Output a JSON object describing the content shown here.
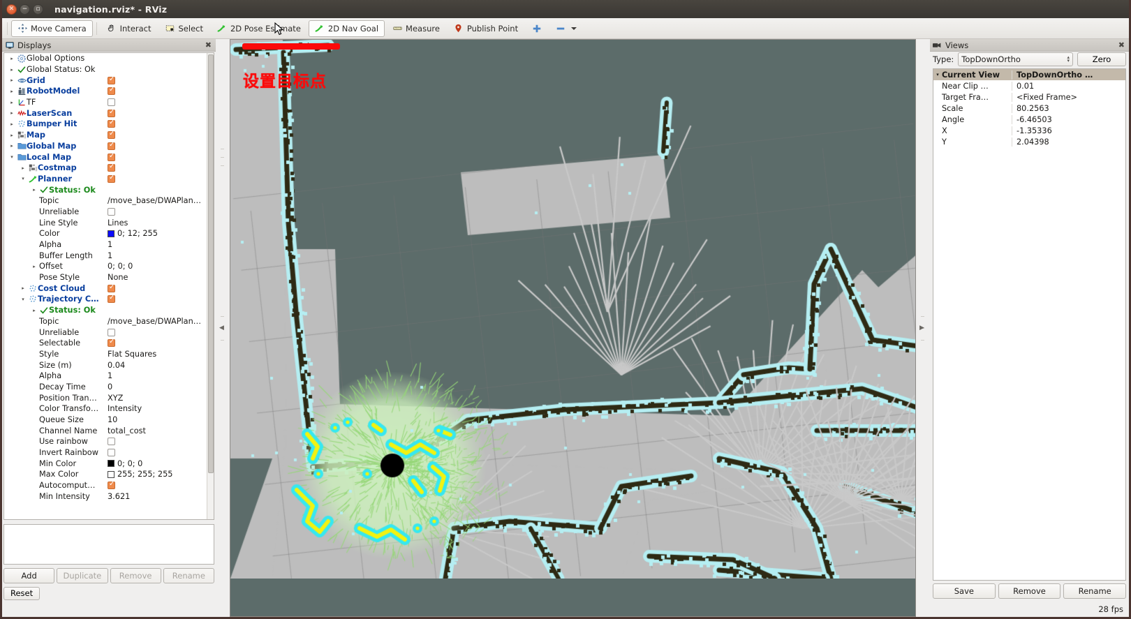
{
  "window": {
    "title": "navigation.rviz* - RViz",
    "controls": [
      "close-button",
      "minimize-button",
      "maximize-button"
    ]
  },
  "toolbar": {
    "items": [
      {
        "label": "Move Camera",
        "icon": "move-camera-icon",
        "active": true
      },
      {
        "label": "Interact",
        "icon": "hand-interact-icon",
        "active": false
      },
      {
        "label": "Select",
        "icon": "select-marquee-icon",
        "active": false
      },
      {
        "label": "2D Pose Estimate",
        "icon": "pose-arrow-icon",
        "active": false
      },
      {
        "label": "2D Nav Goal",
        "icon": "nav-goal-arrow-icon",
        "active": true
      },
      {
        "label": "Measure",
        "icon": "measure-icon",
        "active": false
      },
      {
        "label": "Publish Point",
        "icon": "map-pin-icon",
        "active": false
      },
      {
        "label": "",
        "icon": "plus-icon",
        "active": false
      },
      {
        "label": "",
        "icon": "minus-icon",
        "active": false
      }
    ]
  },
  "displays": {
    "title": "Displays",
    "tree": [
      {
        "indent": 0,
        "arrow": "▸",
        "icon": "gear-icon",
        "label": "Global Options",
        "style": "plain",
        "value": null,
        "check": null
      },
      {
        "indent": 0,
        "arrow": "▸",
        "icon": "check-icon",
        "label": "Global Status: Ok",
        "style": "plain",
        "value": null,
        "check": null
      },
      {
        "indent": 0,
        "arrow": "▸",
        "icon": "grid-icon",
        "label": "Grid",
        "style": "display",
        "value": null,
        "check": true
      },
      {
        "indent": 0,
        "arrow": "▸",
        "icon": "robot-icon",
        "label": "RobotModel",
        "style": "display",
        "value": null,
        "check": true
      },
      {
        "indent": 0,
        "arrow": "▸",
        "icon": "tf-axes-icon",
        "label": "TF",
        "style": "plain",
        "value": null,
        "check": false
      },
      {
        "indent": 0,
        "arrow": "▸",
        "icon": "laserscan-icon",
        "label": "LaserScan",
        "style": "display",
        "value": null,
        "check": true
      },
      {
        "indent": 0,
        "arrow": "▸",
        "icon": "pointcloud-icon",
        "label": "Bumper Hit",
        "style": "display",
        "value": null,
        "check": true
      },
      {
        "indent": 0,
        "arrow": "▸",
        "icon": "map-icon",
        "label": "Map",
        "style": "display",
        "value": null,
        "check": true
      },
      {
        "indent": 0,
        "arrow": "▸",
        "icon": "folder-icon",
        "label": "Global Map",
        "style": "display",
        "value": null,
        "check": true
      },
      {
        "indent": 0,
        "arrow": "▾",
        "icon": "folder-icon",
        "label": "Local Map",
        "style": "display",
        "value": null,
        "check": true
      },
      {
        "indent": 1,
        "arrow": "▸",
        "icon": "map-icon",
        "label": "Costmap",
        "style": "display",
        "value": null,
        "check": true
      },
      {
        "indent": 1,
        "arrow": "▾",
        "icon": "path-icon",
        "label": "Planner",
        "style": "display",
        "value": null,
        "check": true
      },
      {
        "indent": 2,
        "arrow": "▸",
        "icon": "check-icon",
        "label": "Status: Ok",
        "style": "plain",
        "value": null,
        "check": null
      },
      {
        "indent": 2,
        "arrow": "",
        "icon": "",
        "label": "Topic",
        "style": "prop",
        "value": "/move_base/DWAPlan…",
        "check": null
      },
      {
        "indent": 2,
        "arrow": "",
        "icon": "",
        "label": "Unreliable",
        "style": "prop",
        "value": null,
        "check": false
      },
      {
        "indent": 2,
        "arrow": "",
        "icon": "",
        "label": "Line Style",
        "style": "prop",
        "value": "Lines",
        "check": null
      },
      {
        "indent": 2,
        "arrow": "",
        "icon": "",
        "label": "Color",
        "style": "prop",
        "value": "0; 12; 255",
        "swatch": "#0c0cff"
      },
      {
        "indent": 2,
        "arrow": "",
        "icon": "",
        "label": "Alpha",
        "style": "prop",
        "value": "1",
        "check": null
      },
      {
        "indent": 2,
        "arrow": "",
        "icon": "",
        "label": "Buffer Length",
        "style": "prop",
        "value": "1",
        "check": null
      },
      {
        "indent": 2,
        "arrow": "▸",
        "icon": "",
        "label": "Offset",
        "style": "prop",
        "value": "0; 0; 0",
        "check": null
      },
      {
        "indent": 2,
        "arrow": "",
        "icon": "",
        "label": "Pose Style",
        "style": "prop",
        "value": "None",
        "check": null
      },
      {
        "indent": 1,
        "arrow": "▸",
        "icon": "pointcloud-icon",
        "label": "Cost Cloud",
        "style": "display",
        "value": null,
        "check": true
      },
      {
        "indent": 1,
        "arrow": "▾",
        "icon": "pointcloud-icon",
        "label": "Trajectory C…",
        "style": "display",
        "value": null,
        "check": true
      },
      {
        "indent": 2,
        "arrow": "▸",
        "icon": "check-icon",
        "label": "Status: Ok",
        "style": "plain",
        "value": null,
        "check": null
      },
      {
        "indent": 2,
        "arrow": "",
        "icon": "",
        "label": "Topic",
        "style": "prop",
        "value": "/move_base/DWAPlan…",
        "check": null
      },
      {
        "indent": 2,
        "arrow": "",
        "icon": "",
        "label": "Unreliable",
        "style": "prop",
        "value": null,
        "check": false
      },
      {
        "indent": 2,
        "arrow": "",
        "icon": "",
        "label": "Selectable",
        "style": "prop",
        "value": null,
        "check": true
      },
      {
        "indent": 2,
        "arrow": "",
        "icon": "",
        "label": "Style",
        "style": "prop",
        "value": "Flat Squares",
        "check": null
      },
      {
        "indent": 2,
        "arrow": "",
        "icon": "",
        "label": "Size (m)",
        "style": "prop",
        "value": "0.04",
        "check": null
      },
      {
        "indent": 2,
        "arrow": "",
        "icon": "",
        "label": "Alpha",
        "style": "prop",
        "value": "1",
        "check": null
      },
      {
        "indent": 2,
        "arrow": "",
        "icon": "",
        "label": "Decay Time",
        "style": "prop",
        "value": "0",
        "check": null
      },
      {
        "indent": 2,
        "arrow": "",
        "icon": "",
        "label": "Position Tran…",
        "style": "prop",
        "value": "XYZ",
        "check": null
      },
      {
        "indent": 2,
        "arrow": "",
        "icon": "",
        "label": "Color Transfo…",
        "style": "prop",
        "value": "Intensity",
        "check": null
      },
      {
        "indent": 2,
        "arrow": "",
        "icon": "",
        "label": "Queue Size",
        "style": "prop",
        "value": "10",
        "check": null
      },
      {
        "indent": 2,
        "arrow": "",
        "icon": "",
        "label": "Channel Name",
        "style": "prop",
        "value": "total_cost",
        "check": null
      },
      {
        "indent": 2,
        "arrow": "",
        "icon": "",
        "label": "Use rainbow",
        "style": "prop",
        "value": null,
        "check": false
      },
      {
        "indent": 2,
        "arrow": "",
        "icon": "",
        "label": "Invert Rainbow",
        "style": "prop",
        "value": null,
        "check": false
      },
      {
        "indent": 2,
        "arrow": "",
        "icon": "",
        "label": "Min Color",
        "style": "prop",
        "value": "0; 0; 0",
        "swatch": "#000000"
      },
      {
        "indent": 2,
        "arrow": "",
        "icon": "",
        "label": "Max Color",
        "style": "prop",
        "value": "255; 255; 255",
        "swatch": "#ffffff"
      },
      {
        "indent": 2,
        "arrow": "",
        "icon": "",
        "label": "Autocomput…",
        "style": "prop",
        "value": null,
        "check": true
      },
      {
        "indent": 2,
        "arrow": "",
        "icon": "",
        "label": "Min Intensity",
        "style": "prop",
        "value": "3.621",
        "check": null
      }
    ],
    "buttons": [
      {
        "label": "Add",
        "enabled": true
      },
      {
        "label": "Duplicate",
        "enabled": false
      },
      {
        "label": "Remove",
        "enabled": false
      },
      {
        "label": "Rename",
        "enabled": false
      }
    ]
  },
  "views": {
    "title": "Views",
    "type_label": "Type:",
    "type_value": "TopDownOrtho",
    "zero_label": "Zero",
    "header": {
      "name": "Current View",
      "value": "TopDownOrtho …"
    },
    "rows": [
      {
        "name": "Near Clip …",
        "value": "0.01"
      },
      {
        "name": "Target Fra…",
        "value": "<Fixed Frame>"
      },
      {
        "name": "Scale",
        "value": "80.2563"
      },
      {
        "name": "Angle",
        "value": "-6.46503"
      },
      {
        "name": "X",
        "value": "-1.35336"
      },
      {
        "name": "Y",
        "value": "2.04398"
      }
    ],
    "buttons": [
      {
        "label": "Save",
        "enabled": true
      },
      {
        "label": "Remove",
        "enabled": true
      },
      {
        "label": "Rename",
        "enabled": true
      }
    ]
  },
  "statusbar": {
    "reset_label": "Reset",
    "fps": "28 fps"
  },
  "viewport": {
    "annotation_text": "设置目标点",
    "annotation_color": "#fb0a0a",
    "colors": {
      "unknown": "#5c6c6a",
      "free": "#bdbdbd",
      "wall": "#2e2a14",
      "inflation": "#b5eef2",
      "costmap_cyan": "#36e8f0",
      "costmap_yellow": "#f2f211",
      "trajectory_green": "#cdf0bd",
      "robot": "#000000",
      "ray": "#c9c9c9",
      "grid": "#a8a8a8"
    }
  }
}
